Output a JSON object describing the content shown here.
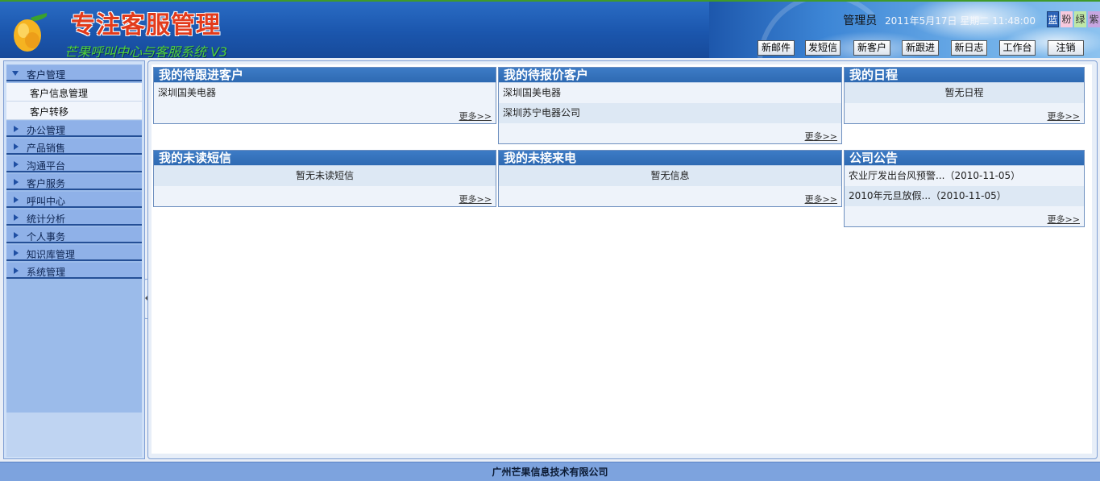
{
  "header": {
    "brand_title": "专注客服管理",
    "brand_subtitle": "芒果呼叫中心与客服系统 V3",
    "user_name": "管理员",
    "datetime": "2011年5月17日  星期二  11:48:00",
    "skins": [
      "蓝",
      "粉",
      "绿",
      "紫"
    ],
    "toolbar": [
      "新邮件",
      "发短信",
      "新客户",
      "新跟进",
      "新日志",
      "工作台",
      "注销"
    ]
  },
  "sidebar": {
    "groups": [
      {
        "label": "客户管理",
        "open": true,
        "children": [
          "客户信息管理",
          "客户转移"
        ]
      },
      {
        "label": "办公管理"
      },
      {
        "label": "产品销售"
      },
      {
        "label": "沟通平台"
      },
      {
        "label": "客户服务"
      },
      {
        "label": "呼叫中心"
      },
      {
        "label": "统计分析"
      },
      {
        "label": "个人事务"
      },
      {
        "label": "知识库管理"
      },
      {
        "label": "系统管理"
      }
    ]
  },
  "panels": {
    "followup": {
      "title": "我的待跟进客户",
      "rows": [
        "深圳国美电器"
      ],
      "more": "更多>>"
    },
    "quote": {
      "title": "我的待报价客户",
      "rows": [
        "深圳国美电器",
        "深圳苏宁电器公司"
      ],
      "more": "更多>>"
    },
    "schedule": {
      "title": "我的日程",
      "rows": [
        "暂无日程"
      ],
      "more": "更多>>"
    },
    "sms": {
      "title": "我的未读短信",
      "rows": [
        "暂无未读短信"
      ],
      "more": "更多>>"
    },
    "calls": {
      "title": "我的未接来电",
      "rows": [
        "暂无信息"
      ],
      "more": "更多>>"
    },
    "notice": {
      "title": "公司公告",
      "rows": [
        "农业厅发出台风预警...（2010-11-05）",
        "2010年元旦放假...（2010-11-05）"
      ],
      "more": "更多>>"
    }
  },
  "footer": {
    "company": "广州芒果信息技术有限公司"
  },
  "colors": {
    "header_blue": "#1b56ad",
    "brand_red": "#e23b1c",
    "subtitle_green": "#4fd13a",
    "panel_title": "#2e6ab2",
    "footer": "#7da3de"
  }
}
